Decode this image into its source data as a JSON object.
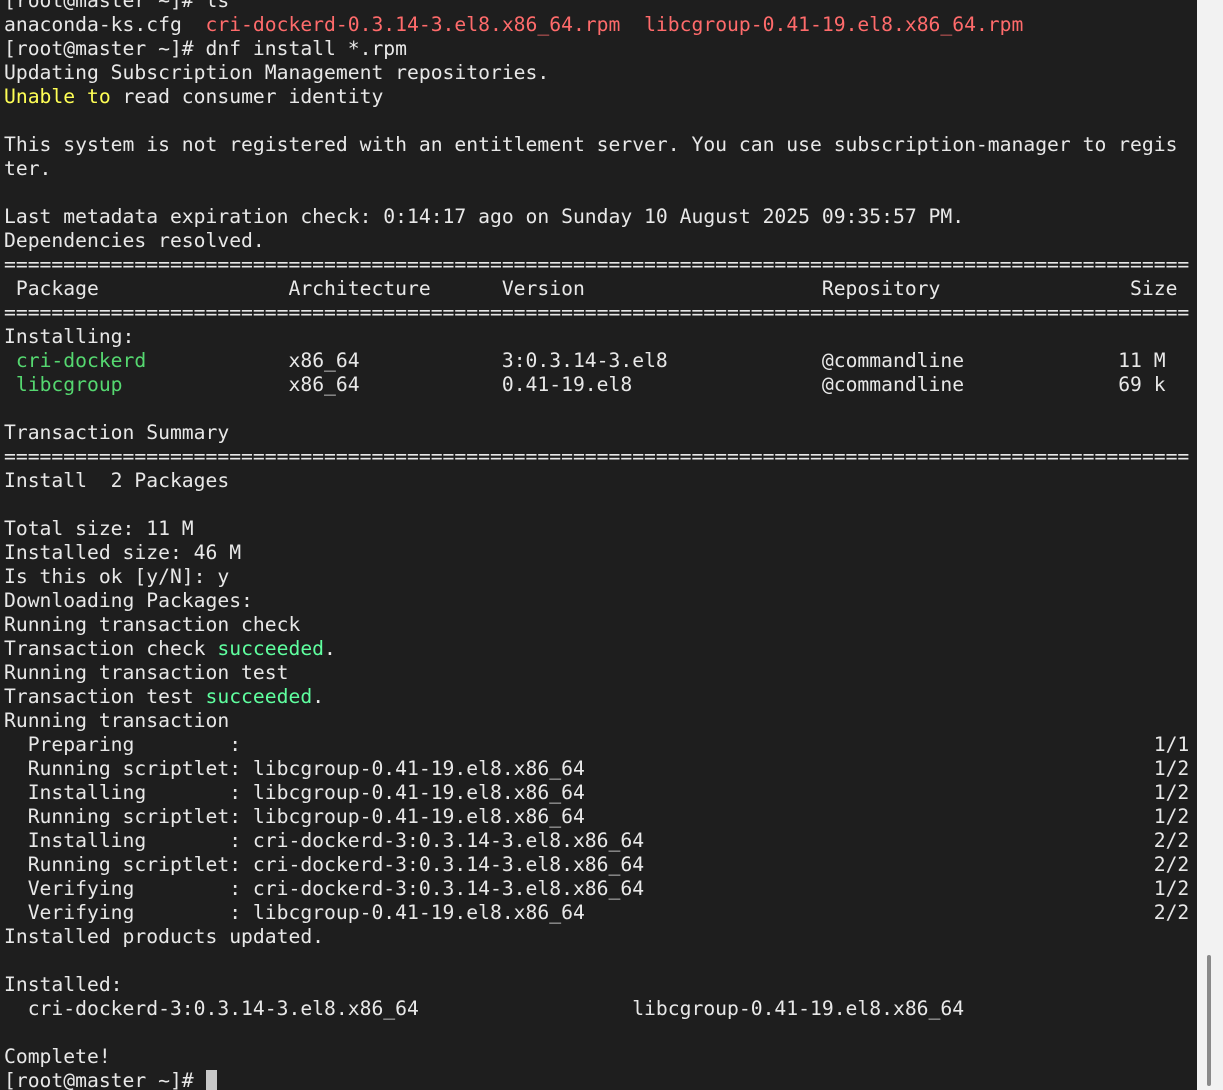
{
  "terminal": {
    "lines": [
      [
        {
          "t": "[root@master ~]# ls",
          "c": ""
        }
      ],
      [
        {
          "t": "anaconda-ks.cfg  ",
          "c": ""
        },
        {
          "t": "cri-dockerd-0.3.14-3.el8.x86_64.rpm",
          "c": "red"
        },
        {
          "t": "  ",
          "c": ""
        },
        {
          "t": "libcgroup-0.41-19.el8.x86_64.rpm",
          "c": "red"
        }
      ],
      [
        {
          "t": "[root@master ~]# dnf install *.rpm",
          "c": ""
        }
      ],
      [
        {
          "t": "Updating Subscription Management repositories.",
          "c": ""
        }
      ],
      [
        {
          "t": "Unable to",
          "c": "yellow"
        },
        {
          "t": " read consumer identity",
          "c": ""
        }
      ],
      [
        {
          "t": "",
          "c": ""
        }
      ],
      [
        {
          "t": "This system is not registered with an entitlement server. You can use subscription-manager to regis",
          "c": ""
        }
      ],
      [
        {
          "t": "ter.",
          "c": ""
        }
      ],
      [
        {
          "t": "",
          "c": ""
        }
      ],
      [
        {
          "t": "Last metadata expiration check: 0:14:17 ago on Sunday 10 August 2025 09:35:57 PM.",
          "c": ""
        }
      ],
      [
        {
          "t": "Dependencies resolved.",
          "c": ""
        }
      ],
      [
        {
          "t": "====================================================================================================",
          "c": ""
        }
      ],
      [
        {
          "t": " Package                Architecture      Version                    Repository                Size",
          "c": ""
        }
      ],
      [
        {
          "t": "====================================================================================================",
          "c": ""
        }
      ],
      [
        {
          "t": "Installing:",
          "c": ""
        }
      ],
      [
        {
          "t": " ",
          "c": ""
        },
        {
          "t": "cri-dockerd",
          "c": "green"
        },
        {
          "t": "            x86_64            3:0.3.14-3.el8             @commandline             11 M",
          "c": ""
        }
      ],
      [
        {
          "t": " ",
          "c": ""
        },
        {
          "t": "libcgroup",
          "c": "green"
        },
        {
          "t": "              x86_64            0.41-19.el8                @commandline             69 k",
          "c": ""
        }
      ],
      [
        {
          "t": "",
          "c": ""
        }
      ],
      [
        {
          "t": "Transaction Summary",
          "c": ""
        }
      ],
      [
        {
          "t": "====================================================================================================",
          "c": ""
        }
      ],
      [
        {
          "t": "Install  2 Packages",
          "c": ""
        }
      ],
      [
        {
          "t": "",
          "c": ""
        }
      ],
      [
        {
          "t": "Total size: 11 M",
          "c": ""
        }
      ],
      [
        {
          "t": "Installed size: 46 M",
          "c": ""
        }
      ],
      [
        {
          "t": "Is this ok [y/N]: y",
          "c": ""
        }
      ],
      [
        {
          "t": "Downloading Packages:",
          "c": ""
        }
      ],
      [
        {
          "t": "Running transaction check",
          "c": ""
        }
      ],
      [
        {
          "t": "Transaction check ",
          "c": ""
        },
        {
          "t": "succeeded",
          "c": "brightgreen"
        },
        {
          "t": ".",
          "c": ""
        }
      ],
      [
        {
          "t": "Running transaction test",
          "c": ""
        }
      ],
      [
        {
          "t": "Transaction test ",
          "c": ""
        },
        {
          "t": "succeeded",
          "c": "brightgreen"
        },
        {
          "t": ".",
          "c": ""
        }
      ],
      [
        {
          "t": "Running transaction",
          "c": ""
        }
      ],
      [
        {
          "t": "  Preparing        :                                                                             1/1",
          "c": ""
        }
      ],
      [
        {
          "t": "  Running scriptlet: libcgroup-0.41-19.el8.x86_64                                                1/2",
          "c": ""
        }
      ],
      [
        {
          "t": "  Installing       : libcgroup-0.41-19.el8.x86_64                                                1/2",
          "c": ""
        }
      ],
      [
        {
          "t": "  Running scriptlet: libcgroup-0.41-19.el8.x86_64                                                1/2",
          "c": ""
        }
      ],
      [
        {
          "t": "  Installing       : cri-dockerd-3:0.3.14-3.el8.x86_64                                           2/2",
          "c": ""
        }
      ],
      [
        {
          "t": "  Running scriptlet: cri-dockerd-3:0.3.14-3.el8.x86_64                                           2/2",
          "c": ""
        }
      ],
      [
        {
          "t": "  Verifying        : cri-dockerd-3:0.3.14-3.el8.x86_64                                           1/2",
          "c": ""
        }
      ],
      [
        {
          "t": "  Verifying        : libcgroup-0.41-19.el8.x86_64                                                2/2",
          "c": ""
        }
      ],
      [
        {
          "t": "Installed products updated.",
          "c": ""
        }
      ],
      [
        {
          "t": "",
          "c": ""
        }
      ],
      [
        {
          "t": "Installed:",
          "c": ""
        }
      ],
      [
        {
          "t": "  cri-dockerd-3:0.3.14-3.el8.x86_64                  libcgroup-0.41-19.el8.x86_64",
          "c": ""
        }
      ],
      [
        {
          "t": "",
          "c": ""
        }
      ],
      [
        {
          "t": "Complete!",
          "c": ""
        }
      ]
    ],
    "prompt": "[root@master ~]# ",
    "colors": {
      "background": "#1e1e1e",
      "foreground": "#e8e8e8",
      "red": "#ff6b6b",
      "yellow": "#ffff55",
      "green": "#55d870",
      "brightgreen": "#5fff9f"
    }
  },
  "scrollbar": {
    "position": 1.0,
    "visible_fraction": 0.12
  }
}
